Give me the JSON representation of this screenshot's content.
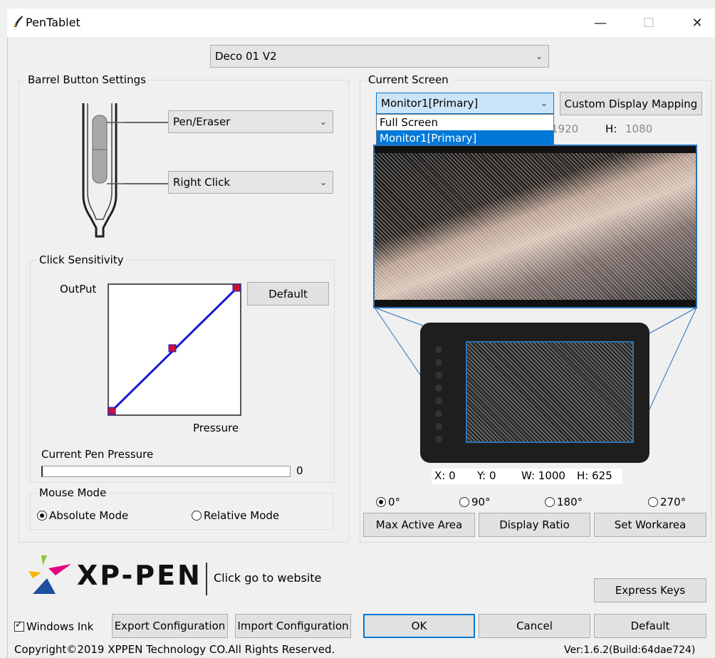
{
  "window": {
    "title": "PenTablet",
    "minimize": "—",
    "maximize": "☐",
    "close": "✕"
  },
  "device": {
    "selected": "Deco 01 V2"
  },
  "barrel": {
    "group_label": "Barrel Button Settings",
    "button1": "Pen/Eraser",
    "button2": "Right Click"
  },
  "sensitivity": {
    "group_label": "Click Sensitivity",
    "output_label": "OutPut",
    "pressure_label": "Pressure",
    "default_label": "Default",
    "current_pressure_label": "Current Pen Pressure",
    "current_pressure_value": "0"
  },
  "mouse_mode": {
    "group_label": "Mouse Mode",
    "absolute": "Absolute Mode",
    "relative": "Relative Mode",
    "selected": "absolute"
  },
  "screen": {
    "group_label": "Current Screen",
    "selected": "Monitor1[Primary]",
    "custom_mapping": "Custom Display Mapping",
    "options": [
      "Full Screen",
      "Monitor1[Primary]"
    ],
    "w_partial": "1920",
    "h_label": "H:",
    "h_value": "1080"
  },
  "area": {
    "x": "X: 0",
    "y": "Y: 0",
    "w": "W: 1000",
    "h": "H: 625"
  },
  "rotation": {
    "options": [
      "0°",
      "90°",
      "180°",
      "270°"
    ],
    "selected": "0°"
  },
  "area_buttons": {
    "max": "Max Active Area",
    "ratio": "Display Ratio",
    "workarea": "Set Workarea"
  },
  "brand": {
    "name": "XP-PEN",
    "website": "Click go to website"
  },
  "bottom": {
    "express_keys": "Express Keys",
    "windows_ink": "Windows Ink",
    "export": "Export Configuration",
    "import": "Import Configuration",
    "ok": "OK",
    "cancel": "Cancel",
    "default": "Default",
    "copyright": "Copyright©2019  XPPEN Technology CO.All Rights Reserved.",
    "version": "Ver:1.6.2(Build:64dae724)"
  },
  "colors": {
    "curve": "#1a1ad6",
    "handle": "#cc1133",
    "selection": "#0078d7",
    "map_line": "#2a6fb8"
  }
}
